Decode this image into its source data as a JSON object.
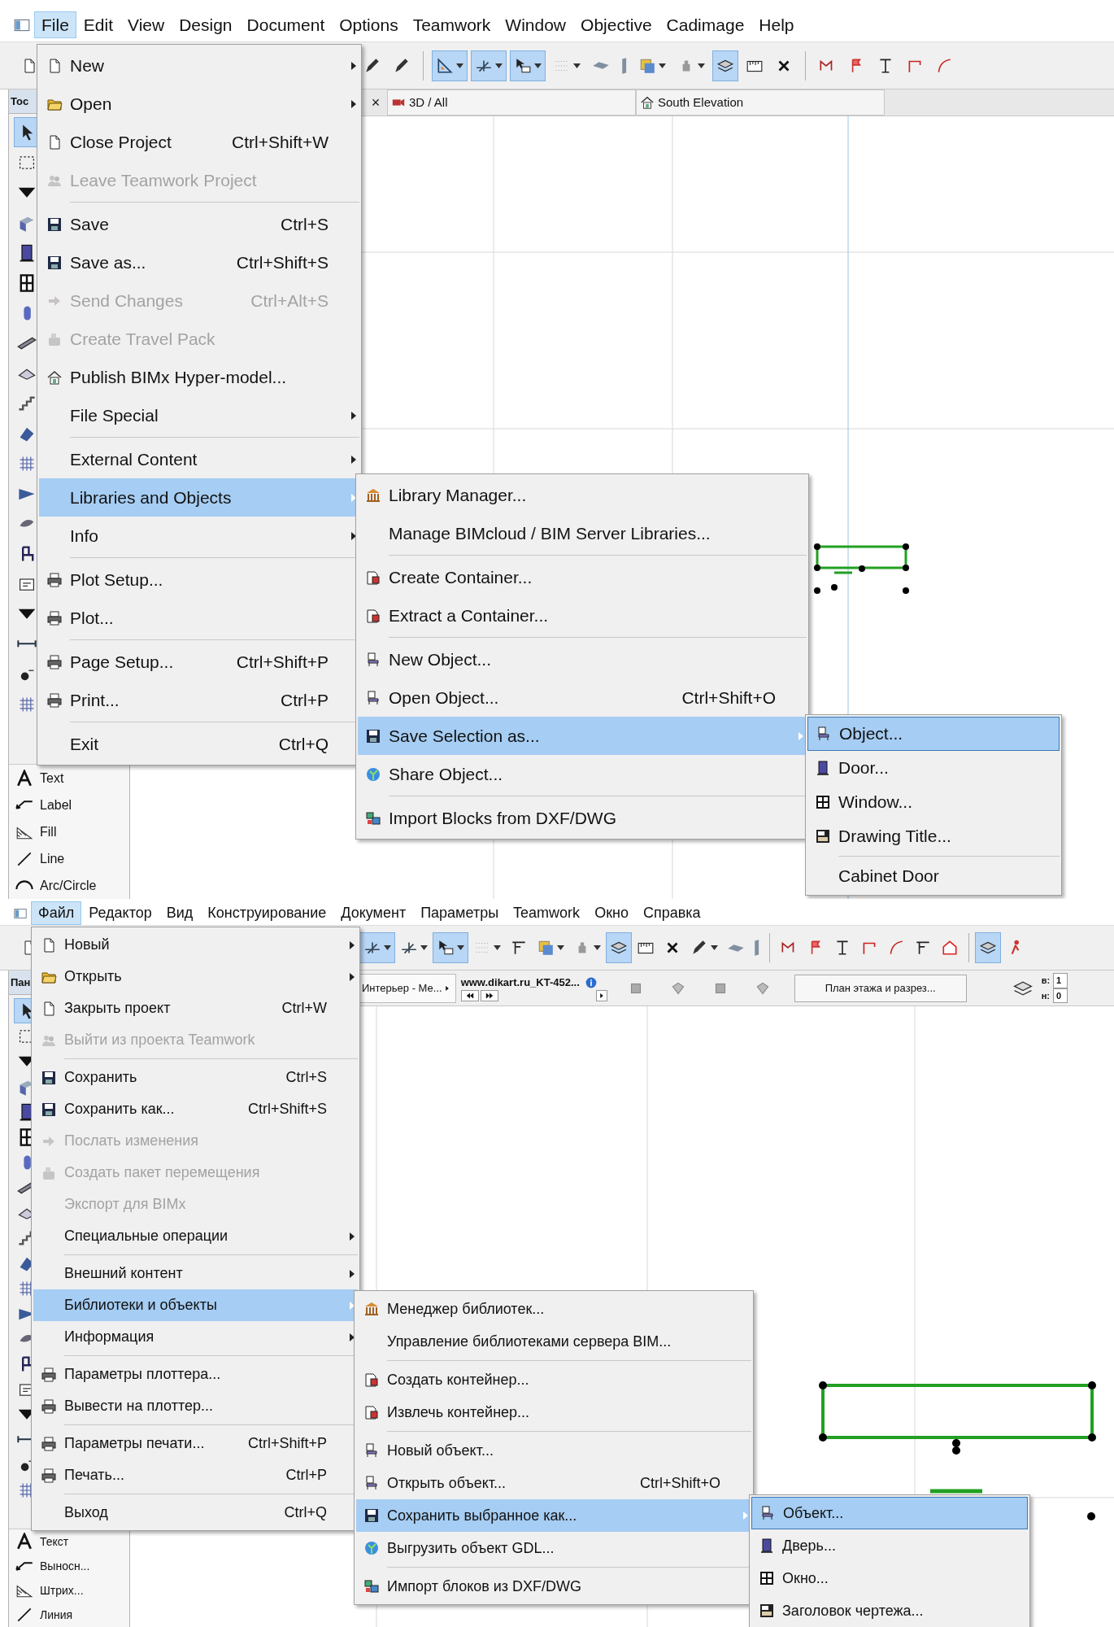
{
  "screens": [
    {
      "menubar": [
        {
          "label": "File",
          "selected": true
        },
        {
          "label": "Edit",
          "selected": false
        },
        {
          "label": "View",
          "selected": false
        },
        {
          "label": "Design",
          "selected": false
        },
        {
          "label": "Document",
          "selected": false
        },
        {
          "label": "Options",
          "selected": false
        },
        {
          "label": "Teamwork",
          "selected": false
        },
        {
          "label": "Window",
          "selected": false
        },
        {
          "label": "Objective",
          "selected": false
        },
        {
          "label": "Cadimage",
          "selected": false
        },
        {
          "label": "Help",
          "selected": false
        }
      ],
      "toolbar": [
        {
          "pressed": false
        },
        {
          "pressed": false
        },
        {
          "pressed": true
        },
        {
          "pressed": true
        },
        {
          "pressed": true
        },
        {
          "pressed": false
        },
        {
          "pressed": false
        },
        {
          "pressed": false
        },
        {
          "pressed": false
        },
        {
          "pressed": false
        },
        {
          "pressed": true
        },
        {
          "pressed": false
        },
        {
          "pressed": false
        },
        {
          "pressed": false
        },
        {
          "pressed": false
        },
        {
          "pressed": false
        },
        {
          "pressed": false
        },
        {
          "pressed": false
        }
      ],
      "toolbox": {
        "header": "Toc",
        "tools": [
          {
            "selected": true
          },
          {
            "selected": false
          },
          {
            "selected": false
          },
          {
            "selected": false
          },
          {
            "selected": false
          },
          {
            "selected": false
          },
          {
            "selected": false
          },
          {
            "selected": false
          },
          {
            "selected": false
          },
          {
            "selected": false
          },
          {
            "selected": false
          },
          {
            "selected": false
          },
          {
            "selected": false
          },
          {
            "selected": false
          },
          {
            "selected": false
          },
          {
            "selected": false
          },
          {
            "selected": false
          },
          {
            "selected": false
          },
          {
            "selected": false
          },
          {
            "selected": false
          }
        ],
        "labeled_tools": [
          {
            "label": "Text"
          },
          {
            "label": "Label"
          },
          {
            "label": "Fill"
          },
          {
            "label": "Line"
          },
          {
            "label": "Arc/Circle"
          }
        ]
      },
      "tab_bar": {
        "close": "×",
        "tabs": [
          {
            "label": "3D / All"
          },
          {
            "label": "South Elevation"
          }
        ]
      },
      "file_menu": {
        "sections": [
          [
            {
              "label": "New",
              "submenu": true,
              "disabled": false,
              "selected": false
            },
            {
              "label": "Open",
              "submenu": true,
              "disabled": false,
              "selected": false
            },
            {
              "label": "Close Project",
              "shortcut": "Ctrl+Shift+W",
              "submenu": false,
              "disabled": false,
              "selected": false
            },
            {
              "label": "Leave Teamwork Project",
              "submenu": false,
              "disabled": true,
              "selected": false
            }
          ],
          [
            {
              "label": "Save",
              "shortcut": "Ctrl+S",
              "submenu": false,
              "disabled": false,
              "selected": false
            },
            {
              "label": "Save as...",
              "shortcut": "Ctrl+Shift+S",
              "submenu": false,
              "disabled": false,
              "selected": false
            },
            {
              "label": "Send Changes",
              "shortcut": "Ctrl+Alt+S",
              "submenu": false,
              "disabled": true,
              "selected": false
            },
            {
              "label": "Create Travel Pack",
              "submenu": false,
              "disabled": true,
              "selected": false
            },
            {
              "label": "Publish BIMx Hyper-model...",
              "submenu": false,
              "disabled": false,
              "selected": false
            },
            {
              "label": "File Special",
              "submenu": true,
              "disabled": false,
              "selected": false
            }
          ],
          [
            {
              "label": "External Content",
              "submenu": true,
              "disabled": false,
              "selected": false
            },
            {
              "label": "Libraries and Objects",
              "submenu": true,
              "disabled": false,
              "selected": true
            },
            {
              "label": "Info",
              "submenu": true,
              "disabled": false,
              "selected": false
            }
          ],
          [
            {
              "label": "Plot Setup...",
              "submenu": false,
              "disabled": false,
              "selected": false
            },
            {
              "label": "Plot...",
              "submenu": false,
              "disabled": false,
              "selected": false
            }
          ],
          [
            {
              "label": "Page Setup...",
              "shortcut": "Ctrl+Shift+P",
              "submenu": false,
              "disabled": false,
              "selected": false
            },
            {
              "label": "Print...",
              "shortcut": "Ctrl+P",
              "submenu": false,
              "disabled": false,
              "selected": false
            }
          ],
          [
            {
              "label": "Exit",
              "shortcut": "Ctrl+Q",
              "submenu": false,
              "disabled": false,
              "selected": false
            }
          ]
        ]
      },
      "libraries_submenu": {
        "sections": [
          [
            {
              "label": "Library Manager...",
              "submenu": false,
              "disabled": false,
              "selected": false
            },
            {
              "label": "Manage BIMcloud / BIM Server Libraries...",
              "submenu": false,
              "disabled": false,
              "selected": false
            }
          ],
          [
            {
              "label": "Create Container...",
              "submenu": false,
              "disabled": false,
              "selected": false
            },
            {
              "label": "Extract a Container...",
              "submenu": false,
              "disabled": false,
              "selected": false
            }
          ],
          [
            {
              "label": "New Object...",
              "submenu": false,
              "disabled": false,
              "selected": false
            },
            {
              "label": "Open Object...",
              "shortcut": "Ctrl+Shift+O",
              "submenu": false,
              "disabled": false,
              "selected": false
            },
            {
              "label": "Save Selection as...",
              "submenu": true,
              "disabled": false,
              "selected": true
            },
            {
              "label": "Share Object...",
              "submenu": false,
              "disabled": false,
              "selected": false
            }
          ],
          [
            {
              "label": "Import Blocks from DXF/DWG",
              "submenu": false,
              "disabled": false,
              "selected": false
            }
          ]
        ]
      },
      "save_selection_submenu": {
        "sections": [
          [
            {
              "label": "Object...",
              "submenu": false,
              "disabled": false,
              "selected": true
            },
            {
              "label": "Door...",
              "submenu": false,
              "disabled": false,
              "selected": false
            },
            {
              "label": "Window...",
              "submenu": false,
              "disabled": false,
              "selected": false
            },
            {
              "label": "Drawing Title...",
              "submenu": false,
              "disabled": false,
              "selected": false
            }
          ],
          [
            {
              "label": "Cabinet Door",
              "submenu": false,
              "disabled": false,
              "selected": false
            }
          ]
        ]
      }
    },
    {
      "menubar": [
        {
          "label": "Файл",
          "selected": true
        },
        {
          "label": "Редактор",
          "selected": false
        },
        {
          "label": "Вид",
          "selected": false
        },
        {
          "label": "Конструирование",
          "selected": false
        },
        {
          "label": "Документ",
          "selected": false
        },
        {
          "label": "Параметры",
          "selected": false
        },
        {
          "label": "Teamwork",
          "selected": false
        },
        {
          "label": "Окно",
          "selected": false
        },
        {
          "label": "Справка",
          "selected": false
        }
      ],
      "toolbar": [
        {
          "pressed": true
        },
        {
          "pressed": false
        },
        {
          "pressed": true
        },
        {
          "pressed": false
        },
        {
          "pressed": false
        },
        {
          "pressed": false
        },
        {
          "pressed": false
        },
        {
          "pressed": true
        },
        {
          "pressed": false
        },
        {
          "pressed": false
        },
        {
          "pressed": false
        },
        {
          "pressed": false
        },
        {
          "pressed": false
        },
        {
          "pressed": false
        },
        {
          "pressed": false
        },
        {
          "pressed": false
        },
        {
          "pressed": false
        },
        {
          "pressed": false
        },
        {
          "pressed": false
        },
        {
          "pressed": false
        },
        {
          "pressed": true
        },
        {
          "pressed": false
        }
      ],
      "toolbox": {
        "header": "Пан",
        "tools": [
          {
            "selected": true
          },
          {
            "selected": false
          },
          {
            "selected": false
          },
          {
            "selected": false
          },
          {
            "selected": false
          },
          {
            "selected": false
          },
          {
            "selected": false
          },
          {
            "selected": false
          },
          {
            "selected": false
          },
          {
            "selected": false
          },
          {
            "selected": false
          },
          {
            "selected": false
          },
          {
            "selected": false
          },
          {
            "selected": false
          },
          {
            "selected": false
          },
          {
            "selected": false
          },
          {
            "selected": false
          },
          {
            "selected": false
          },
          {
            "selected": false
          },
          {
            "selected": false
          }
        ],
        "labeled_tools": [
          {
            "label": "Текст"
          },
          {
            "label": "Выносн..."
          },
          {
            "label": "Штрих..."
          },
          {
            "label": "Линия"
          }
        ]
      },
      "info_bar": {
        "view_set": "Интерьер - Ме...",
        "layout_name": "www.dikart.ru_KT-452...",
        "view_button": "План этажа и разрез...",
        "top_label": "в:",
        "top_value": "1",
        "bottom_label": "н:",
        "bottom_value": "0"
      },
      "file_menu": {
        "sections": [
          [
            {
              "label": "Новый",
              "submenu": true,
              "disabled": false,
              "selected": false
            },
            {
              "label": "Открыть",
              "submenu": true,
              "disabled": false,
              "selected": false
            },
            {
              "label": "Закрыть проект",
              "shortcut": "Ctrl+W",
              "submenu": false,
              "disabled": false,
              "selected": false
            },
            {
              "label": "Выйти из проекта Teamwork",
              "submenu": false,
              "disabled": true,
              "selected": false
            }
          ],
          [
            {
              "label": "Сохранить",
              "shortcut": "Ctrl+S",
              "submenu": false,
              "disabled": false,
              "selected": false
            },
            {
              "label": "Сохранить как...",
              "shortcut": "Ctrl+Shift+S",
              "submenu": false,
              "disabled": false,
              "selected": false
            },
            {
              "label": "Послать изменения",
              "submenu": false,
              "disabled": true,
              "selected": false
            },
            {
              "label": "Создать пакет перемещения",
              "submenu": false,
              "disabled": true,
              "selected": false
            },
            {
              "label": "Экспорт для BIMx",
              "submenu": false,
              "disabled": true,
              "selected": false
            },
            {
              "label": "Специальные операции",
              "submenu": true,
              "disabled": false,
              "selected": false
            }
          ],
          [
            {
              "label": "Внешний контент",
              "submenu": true,
              "disabled": false,
              "selected": false
            },
            {
              "label": "Библиотеки и объекты",
              "submenu": true,
              "disabled": false,
              "selected": true
            },
            {
              "label": "Информация",
              "submenu": true,
              "disabled": false,
              "selected": false
            }
          ],
          [
            {
              "label": "Параметры плоттера...",
              "submenu": false,
              "disabled": false,
              "selected": false
            },
            {
              "label": "Вывести на плоттер...",
              "submenu": false,
              "disabled": false,
              "selected": false
            }
          ],
          [
            {
              "label": "Параметры печати...",
              "shortcut": "Ctrl+Shift+P",
              "submenu": false,
              "disabled": false,
              "selected": false
            },
            {
              "label": "Печать...",
              "shortcut": "Ctrl+P",
              "submenu": false,
              "disabled": false,
              "selected": false
            }
          ],
          [
            {
              "label": "Выход",
              "shortcut": "Ctrl+Q",
              "submenu": false,
              "disabled": false,
              "selected": false
            }
          ]
        ]
      },
      "libraries_submenu": {
        "sections": [
          [
            {
              "label": "Менеджер библиотек...",
              "submenu": false,
              "disabled": false,
              "selected": false
            },
            {
              "label": "Управление библиотеками сервера BIM...",
              "submenu": false,
              "disabled": false,
              "selected": false
            }
          ],
          [
            {
              "label": "Создать контейнер...",
              "submenu": false,
              "disabled": false,
              "selected": false
            },
            {
              "label": "Извлечь контейнер...",
              "submenu": false,
              "disabled": false,
              "selected": false
            }
          ],
          [
            {
              "label": "Новый объект...",
              "submenu": false,
              "disabled": false,
              "selected": false
            },
            {
              "label": "Открыть объект...",
              "shortcut": "Ctrl+Shift+O",
              "submenu": false,
              "disabled": false,
              "selected": false
            },
            {
              "label": "Сохранить выбранное как...",
              "submenu": true,
              "disabled": false,
              "selected": true
            },
            {
              "label": "Выгрузить объект GDL...",
              "submenu": false,
              "disabled": false,
              "selected": false
            }
          ],
          [
            {
              "label": "Импорт блоков из DXF/DWG",
              "submenu": false,
              "disabled": false,
              "selected": false
            }
          ]
        ]
      },
      "save_selection_submenu": {
        "sections": [
          [
            {
              "label": "Объект...",
              "submenu": false,
              "disabled": false,
              "selected": true
            },
            {
              "label": "Дверь...",
              "submenu": false,
              "disabled": false,
              "selected": false
            },
            {
              "label": "Окно...",
              "submenu": false,
              "disabled": false,
              "selected": false
            },
            {
              "label": "Заголовок чертежа...",
              "submenu": false,
              "disabled": false,
              "selected": false
            }
          ]
        ]
      }
    }
  ]
}
